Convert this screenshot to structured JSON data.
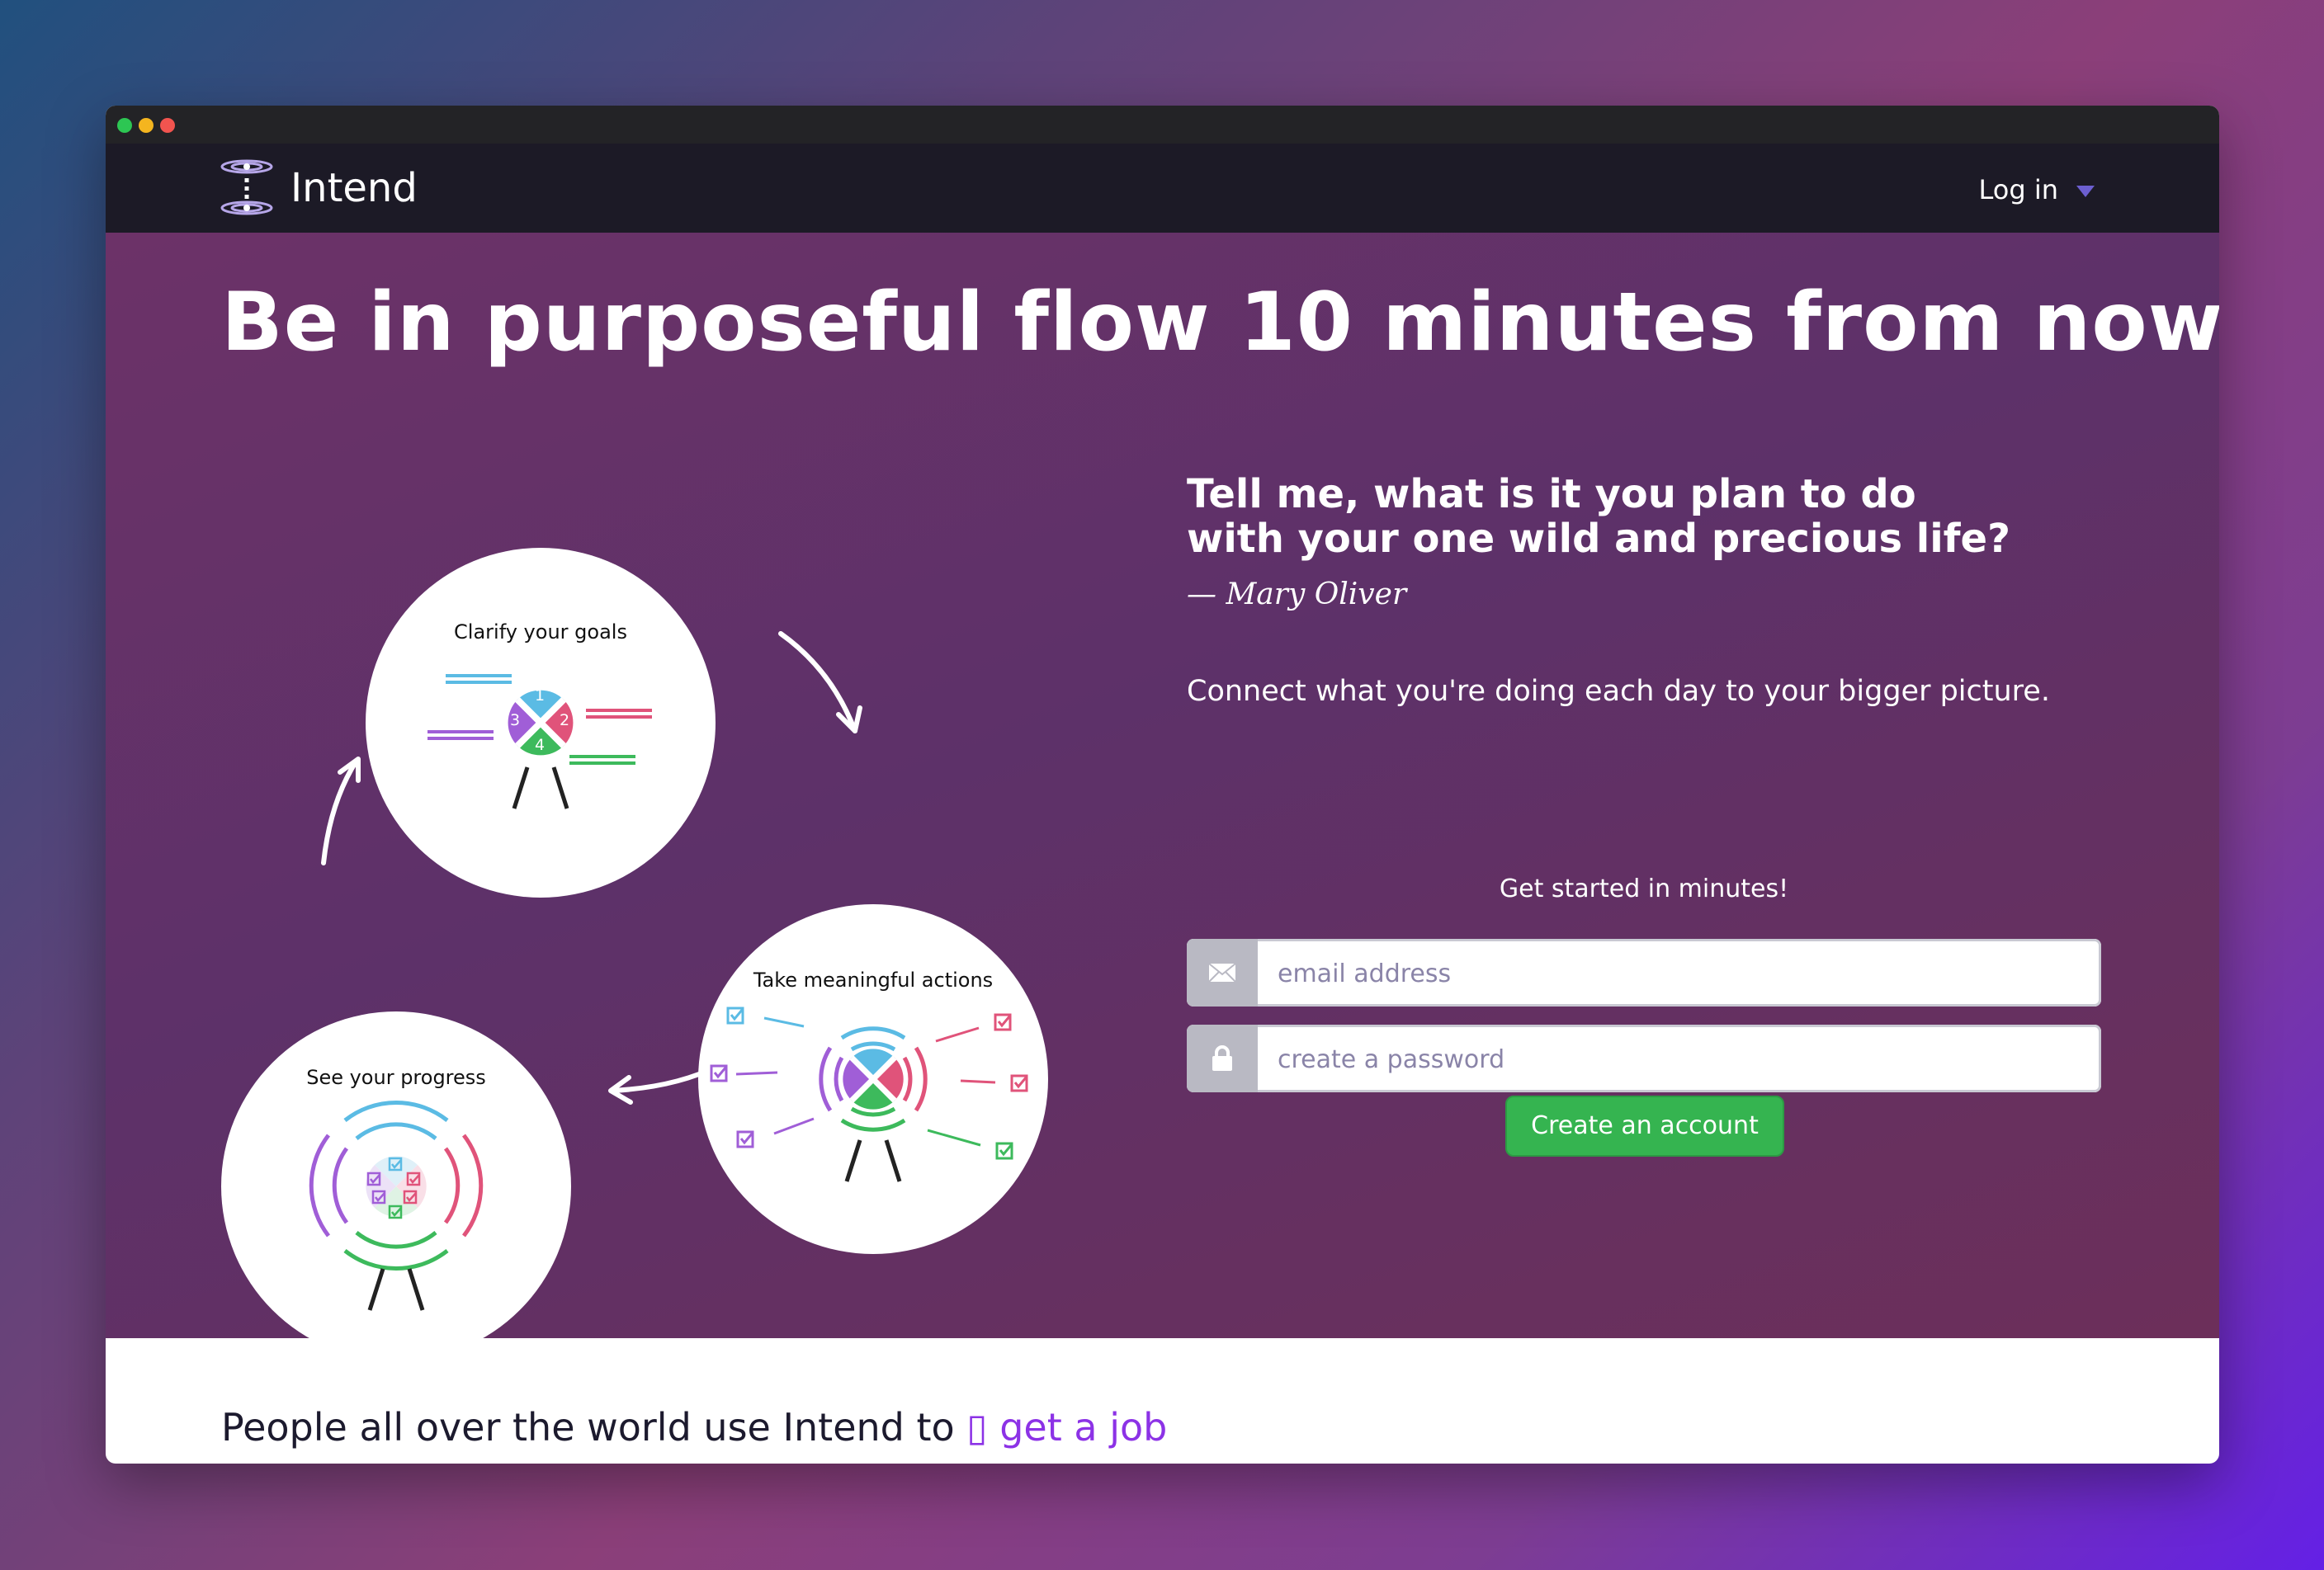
{
  "window": {
    "controls": [
      "green",
      "yellow",
      "red"
    ]
  },
  "navbar": {
    "brand": "Intend",
    "logo_icon": "intend-logo-icon",
    "login_label": "Log in",
    "login_icon": "caret-down-icon"
  },
  "hero": {
    "headline": "Be in purposeful flow 10 minutes from now",
    "cycle": [
      {
        "title": "Clarify your goals",
        "numbers": [
          "1",
          "2",
          "3",
          "4"
        ]
      },
      {
        "title": "Take meaningful actions"
      },
      {
        "title": "See your progress"
      }
    ],
    "quote_line1": "Tell me, what is it you plan to do",
    "quote_line2": "with your one wild and precious life?",
    "quote_author": "— Mary Oliver",
    "tagline": "Connect what you're doing each day to your bigger picture.",
    "signup": {
      "heading": "Get started in minutes!",
      "email_placeholder": "email address",
      "email_icon": "envelope-icon",
      "password_placeholder": "create a password",
      "password_icon": "lock-icon",
      "submit_label": "Create an account"
    }
  },
  "below": {
    "prefix": "People all over the world use Intend to",
    "rotating_item": "get a job"
  },
  "colors": {
    "blue": "#5bbbe4",
    "pink": "#e0537a",
    "purple": "#a05ed7",
    "green": "#3dba5c",
    "cta": "#35b450",
    "nav": "#1c1a26"
  }
}
